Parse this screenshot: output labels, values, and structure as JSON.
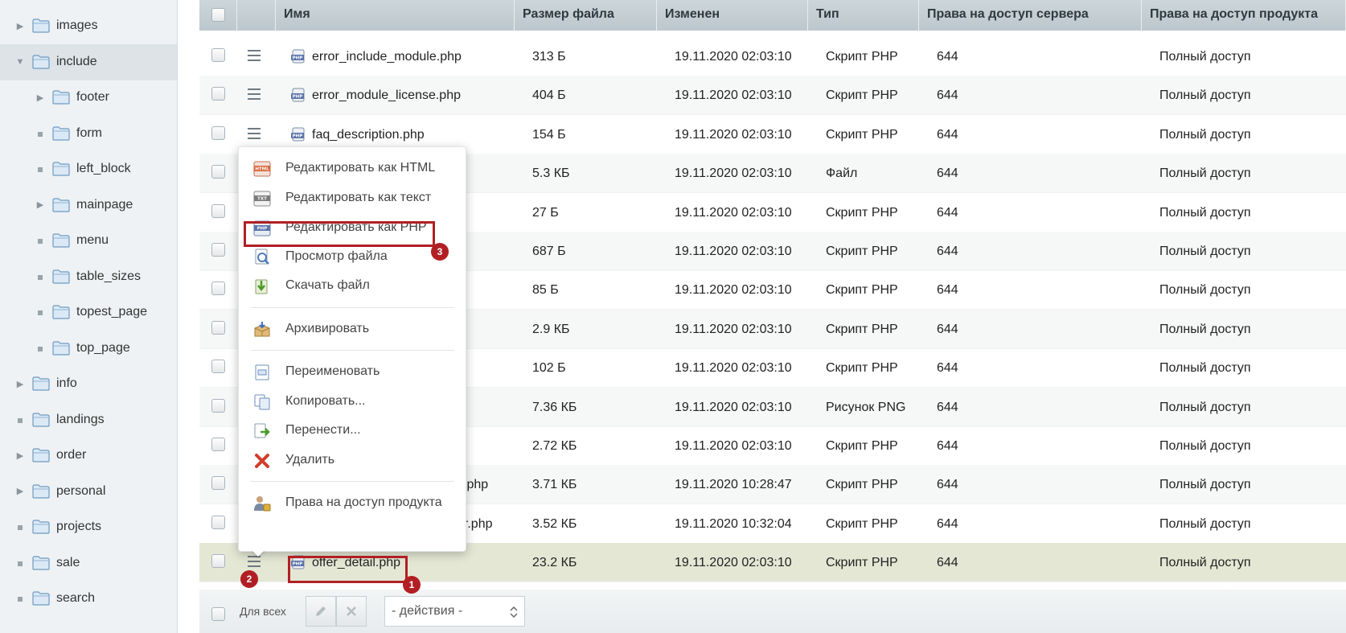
{
  "sidebar": {
    "items": [
      {
        "label": "images",
        "type": "collapsed"
      },
      {
        "label": "include",
        "type": "expanded"
      },
      {
        "label": "footer",
        "type": "collapsed"
      },
      {
        "label": "form",
        "type": "leaf"
      },
      {
        "label": "left_block",
        "type": "leaf"
      },
      {
        "label": "mainpage",
        "type": "collapsed"
      },
      {
        "label": "menu",
        "type": "leaf"
      },
      {
        "label": "table_sizes",
        "type": "leaf"
      },
      {
        "label": "topest_page",
        "type": "leaf"
      },
      {
        "label": "top_page",
        "type": "leaf"
      },
      {
        "label": "info",
        "type": "collapsed"
      },
      {
        "label": "landings",
        "type": "leaf"
      },
      {
        "label": "order",
        "type": "collapsed"
      },
      {
        "label": "personal",
        "type": "collapsed"
      },
      {
        "label": "projects",
        "type": "leaf"
      },
      {
        "label": "sale",
        "type": "leaf"
      },
      {
        "label": "search",
        "type": "leaf"
      }
    ]
  },
  "table": {
    "columns": [
      "Имя",
      "Размер файла",
      "Изменен",
      "Тип",
      "Права на доступ сервера",
      "Права на доступ продукта"
    ],
    "rows": [
      {
        "name": "error_include_module.php",
        "size": "313 Б",
        "modified": "19.11.2020 02:03:10",
        "type": "Скрипт PHP",
        "server": "644",
        "product": "Полный доступ"
      },
      {
        "name": "error_module_license.php",
        "size": "404 Б",
        "modified": "19.11.2020 02:03:10",
        "type": "Скрипт PHP",
        "server": "644",
        "product": "Полный доступ"
      },
      {
        "name": "faq_description.php",
        "size": "154 Б",
        "modified": "19.11.2020 02:03:10",
        "type": "Скрипт PHP",
        "server": "644",
        "product": "Полный доступ"
      },
      {
        "name": "",
        "size": "5.3 КБ",
        "modified": "19.11.2020 02:03:10",
        "type": "Файл",
        "server": "644",
        "product": "Полный доступ"
      },
      {
        "name": "",
        "size": "27 Б",
        "modified": "19.11.2020 02:03:10",
        "type": "Скрипт PHP",
        "server": "644",
        "product": "Полный доступ"
      },
      {
        "name": "",
        "size": "687 Б",
        "modified": "19.11.2020 02:03:10",
        "type": "Скрипт PHP",
        "server": "644",
        "product": "Полный доступ"
      },
      {
        "name": "",
        "size": "85 Б",
        "modified": "19.11.2020 02:03:10",
        "type": "Скрипт PHP",
        "server": "644",
        "product": "Полный доступ"
      },
      {
        "name": "",
        "size": "2.9 КБ",
        "modified": "19.11.2020 02:03:10",
        "type": "Скрипт PHP",
        "server": "644",
        "product": "Полный доступ"
      },
      {
        "name": "",
        "size": "102 Б",
        "modified": "19.11.2020 02:03:10",
        "type": "Скрипт PHP",
        "server": "644",
        "product": "Полный доступ"
      },
      {
        "name": "",
        "size": "7.36 КБ",
        "modified": "19.11.2020 02:03:10",
        "type": "Рисунок PNG",
        "server": "644",
        "product": "Полный доступ"
      },
      {
        "name": "",
        "size": "2.72 КБ",
        "modified": "19.11.2020 02:03:10",
        "type": "Скрипт PHP",
        "server": "644",
        "product": "Полный доступ"
      },
      {
        "name": "k.php",
        "size": "3.71 КБ",
        "modified": "19.11.2020 10:28:47",
        "type": "Скрипт PHP",
        "server": "644",
        "product": "Полный доступ"
      },
      {
        "name": "er.php",
        "size": "3.52 КБ",
        "modified": "19.11.2020 10:32:04",
        "type": "Скрипт PHP",
        "server": "644",
        "product": "Полный доступ"
      },
      {
        "name": "offer_detail.php",
        "size": "23.2 КБ",
        "modified": "19.11.2020 02:03:10",
        "type": "Скрипт PHP",
        "server": "644",
        "product": "Полный доступ"
      }
    ]
  },
  "context_menu": {
    "items": [
      {
        "label": "Редактировать как HTML",
        "icon": "html-edit-icon"
      },
      {
        "label": "Редактировать как текст",
        "icon": "txt-edit-icon"
      },
      {
        "label": "Редактировать как PHP",
        "icon": "php-edit-icon"
      },
      {
        "label": "Просмотр файла",
        "icon": "view-file-icon"
      },
      {
        "label": "Скачать файл",
        "icon": "download-icon"
      },
      {
        "label": "Архивировать",
        "icon": "archive-icon"
      },
      {
        "label": "Переименовать",
        "icon": "rename-icon"
      },
      {
        "label": "Копировать...",
        "icon": "copy-icon"
      },
      {
        "label": "Перенести...",
        "icon": "move-icon"
      },
      {
        "label": "Удалить",
        "icon": "delete-icon"
      },
      {
        "label": "Права на доступ продукта",
        "icon": "access-rights-icon"
      }
    ]
  },
  "annotations": {
    "badge1": "1",
    "badge2": "2",
    "badge3": "3"
  },
  "footer": {
    "for_all_label": "Для всех",
    "actions_placeholder": "- действия -"
  },
  "colors": {
    "annotation_red": "#b11f24",
    "header_bg": "#c4cfd5",
    "highlight_row": "#e4e7d4"
  }
}
